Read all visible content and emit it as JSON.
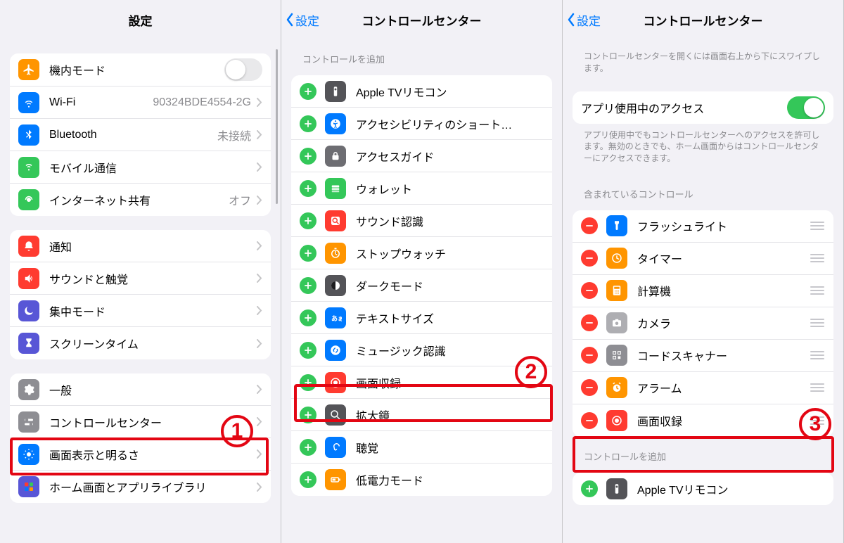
{
  "panel1": {
    "title": "設定",
    "groups": [
      {
        "rows": [
          {
            "icon": "airplane-icon",
            "color": "c-orange",
            "label": "機内モード",
            "control": "toggle-off"
          },
          {
            "icon": "wifi-icon",
            "color": "c-blue",
            "label": "Wi-Fi",
            "value": "90324BDE4554-2G",
            "control": "chevron"
          },
          {
            "icon": "bluetooth-icon",
            "color": "c-blue",
            "label": "Bluetooth",
            "value": "未接続",
            "control": "chevron"
          },
          {
            "icon": "cellular-icon",
            "color": "c-green",
            "label": "モバイル通信",
            "control": "chevron"
          },
          {
            "icon": "hotspot-icon",
            "color": "c-green",
            "label": "インターネット共有",
            "value": "オフ",
            "control": "chevron"
          }
        ]
      },
      {
        "rows": [
          {
            "icon": "notif-icon",
            "color": "c-red",
            "label": "通知",
            "control": "chevron"
          },
          {
            "icon": "sound-icon",
            "color": "c-red",
            "label": "サウンドと触覚",
            "control": "chevron"
          },
          {
            "icon": "moon-icon",
            "color": "c-purple",
            "label": "集中モード",
            "control": "chevron"
          },
          {
            "icon": "hourglass-icon",
            "color": "c-purple",
            "label": "スクリーンタイム",
            "control": "chevron"
          }
        ]
      },
      {
        "rows": [
          {
            "icon": "gear-icon",
            "color": "c-gray",
            "label": "一般",
            "control": "chevron"
          },
          {
            "icon": "switches-icon",
            "color": "c-gray",
            "label": "コントロールセンター",
            "control": "chevron"
          },
          {
            "icon": "display-icon",
            "color": "c-blue",
            "label": "画面表示と明るさ",
            "control": "chevron"
          },
          {
            "icon": "home-icon",
            "color": "c-purple",
            "label": "ホーム画面とアプリライブラリ",
            "control": "chevron"
          }
        ]
      }
    ]
  },
  "panel2": {
    "back": "設定",
    "title": "コントロールセンター",
    "section": "コントロールを追加",
    "rows": [
      {
        "icon": "remote-icon",
        "color": "c-slate",
        "label": "Apple TVリモコン"
      },
      {
        "icon": "a11y-icon",
        "color": "c-blue",
        "label": "アクセシビリティのショート…"
      },
      {
        "icon": "lock-icon",
        "color": "c-darkgray",
        "label": "アクセスガイド"
      },
      {
        "icon": "wallet-icon",
        "color": "c-green",
        "label": "ウォレット"
      },
      {
        "icon": "ear-icon",
        "color": "c-red",
        "label": "サウンド認識"
      },
      {
        "icon": "stopwatch-icon",
        "color": "c-orange",
        "label": "ストップウォッチ"
      },
      {
        "icon": "dark-icon",
        "color": "c-slate",
        "label": "ダークモード"
      },
      {
        "icon": "text-icon",
        "color": "c-blue",
        "label": "テキストサイズ"
      },
      {
        "icon": "shazam-icon",
        "color": "c-blue",
        "label": "ミュージック認識"
      },
      {
        "icon": "record-icon",
        "color": "c-red",
        "label": "画面収録"
      },
      {
        "icon": "magnifier-icon",
        "color": "c-slate",
        "label": "拡大鏡"
      },
      {
        "icon": "hearing-icon",
        "color": "c-blue",
        "label": "聴覚"
      },
      {
        "icon": "battery-icon",
        "color": "c-orange",
        "label": "低電力モード"
      }
    ]
  },
  "panel3": {
    "back": "設定",
    "title": "コントロールセンター",
    "intro": "コントロールセンターを開くには画面右上から下にスワイプします。",
    "access_label": "アプリ使用中のアクセス",
    "access_footer": "アプリ使用中でもコントロールセンターへのアクセスを許可します。無効のときでも、ホーム画面からはコントロールセンターにアクセスできます。",
    "included_label": "含まれているコントロール",
    "included": [
      {
        "icon": "flashlight-icon",
        "color": "c-blue",
        "label": "フラッシュライト"
      },
      {
        "icon": "timer-icon",
        "color": "c-orange",
        "label": "タイマー"
      },
      {
        "icon": "calc-icon",
        "color": "c-orange",
        "label": "計算機"
      },
      {
        "icon": "camera-icon",
        "color": "c-lightgray",
        "label": "カメラ"
      },
      {
        "icon": "qr-icon",
        "color": "c-gray",
        "label": "コードスキャナー"
      },
      {
        "icon": "alarm-icon",
        "color": "c-orange",
        "label": "アラーム"
      },
      {
        "icon": "record-icon",
        "color": "c-red",
        "label": "画面収録"
      }
    ],
    "add_label": "コントロールを追加",
    "add_rows": [
      {
        "icon": "remote-icon",
        "color": "c-slate",
        "label": "Apple TVリモコン"
      }
    ]
  },
  "annotations": {
    "n1": "1",
    "n2": "2",
    "n3": "3"
  }
}
